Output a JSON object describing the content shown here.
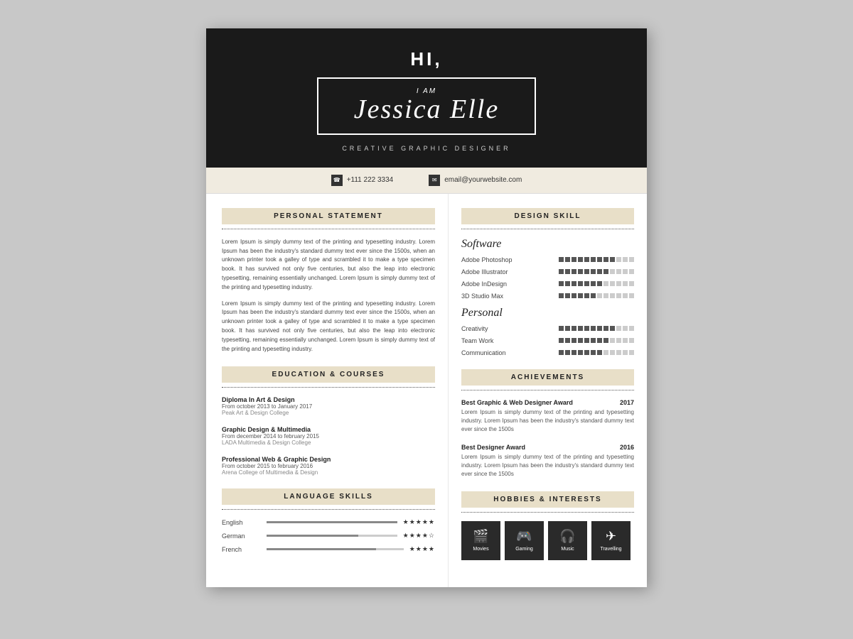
{
  "header": {
    "greeting": "HI,",
    "i_am": "I AM",
    "name": "Jessica Elle",
    "title": "CREATIVE GRAPHIC DESIGNER"
  },
  "contact": {
    "phone": "+111 222 3334",
    "email": "email@yourwebsite.com"
  },
  "personal_statement": {
    "label": "PERSONAL STATEMENT",
    "paragraph1": "Lorem Ipsum is simply dummy text of the printing and typesetting industry. Lorem Ipsum has been the industry's standard dummy text ever since the 1500s, when an unknown printer took a galley of type and scrambled it to make a type specimen book. It has survived not only five centuries, but also the leap into electronic typesetting, remaining essentially unchanged. Lorem Ipsum is simply dummy text of the printing and typesetting industry.",
    "paragraph2": "Lorem Ipsum is simply dummy text of the printing and typesetting industry. Lorem Ipsum has been the industry's standard dummy text ever since the 1500s, when an unknown printer took a galley of type and scrambled it to make a type specimen book. It has survived not only five centuries, but also the leap into electronic typesetting, remaining essentially unchanged. Lorem Ipsum is simply dummy text of the printing and typesetting industry."
  },
  "education": {
    "label": "EDUCATION & COURSES",
    "items": [
      {
        "title": "Diploma In Art & Design",
        "date": "From october 2013 to January 2017",
        "school": "Peak Art & Design College"
      },
      {
        "title": "Graphic Design & Multimedia",
        "date": "From december 2014 to february 2015",
        "school": "LADA Multimedia & Design College"
      },
      {
        "title": "Professional Web & Graphic Design",
        "date": "From october 2015 to february 2016",
        "school": "Arena College of Multimedia & Design"
      }
    ]
  },
  "language_skills": {
    "label": "LANGUAGE SKILLS",
    "items": [
      {
        "name": "English",
        "fill_pct": 100,
        "stars": "★★★★★",
        "empty_stars": ""
      },
      {
        "name": "German",
        "fill_pct": 70,
        "stars": "★★★★",
        "empty_stars": "☆"
      },
      {
        "name": "French",
        "fill_pct": 80,
        "stars": "★★★★",
        "empty_stars": ""
      }
    ]
  },
  "design_skill": {
    "label": "DESIGN SKILL",
    "software_label": "Software",
    "software_items": [
      {
        "name": "Adobe Photoshop",
        "filled": 9,
        "empty": 3
      },
      {
        "name": "Adobe Illustrator",
        "filled": 8,
        "empty": 4
      },
      {
        "name": "Adobe InDesign",
        "filled": 7,
        "empty": 5
      },
      {
        "name": "3D Studio Max",
        "filled": 6,
        "empty": 6
      }
    ],
    "personal_label": "Personal",
    "personal_items": [
      {
        "name": "Creativity",
        "filled": 9,
        "empty": 3
      },
      {
        "name": "Team Work",
        "filled": 8,
        "empty": 4
      },
      {
        "name": "Communication",
        "filled": 7,
        "empty": 5
      }
    ]
  },
  "achievements": {
    "label": "ACHIEVEMENTS",
    "items": [
      {
        "title": "Best Graphic & Web Designer Award",
        "year": "2017",
        "text": "Lorem Ipsum is simply dummy text of the printing and typesetting industry. Lorem Ipsum has been the industry's standard dummy text ever since the 1500s"
      },
      {
        "title": "Best Designer Award",
        "year": "2016",
        "text": "Lorem Ipsum is simply dummy text of the printing and typesetting industry. Lorem Ipsum has been the industry's standard dummy text ever since the 1500s"
      }
    ]
  },
  "hobbies": {
    "label": "HOBBIES & INTERESTS",
    "items": [
      {
        "icon": "🎬",
        "label": "Movies"
      },
      {
        "icon": "🎮",
        "label": "Gaming"
      },
      {
        "icon": "🎧",
        "label": "Music"
      },
      {
        "icon": "✈",
        "label": "Travelling"
      }
    ]
  }
}
